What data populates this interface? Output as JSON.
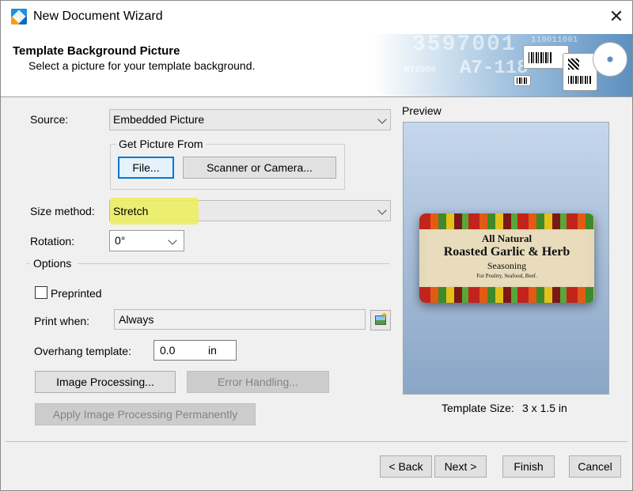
{
  "window": {
    "title": "New Document Wizard"
  },
  "header": {
    "title": "Template Background Picture",
    "subtitle": "Select a picture for your template background.",
    "banner_text": [
      "3597001",
      "A7-118",
      "RY2000",
      "110011001"
    ]
  },
  "source": {
    "label": "Source:",
    "value": "Embedded Picture"
  },
  "get_picture": {
    "label": "Get Picture From",
    "file_button": "File...",
    "scanner_button": "Scanner or Camera..."
  },
  "size_method": {
    "label": "Size method:",
    "value": "Stretch"
  },
  "rotation": {
    "label": "Rotation:",
    "value": "0°"
  },
  "options": {
    "label": "Options",
    "preprinted_label": "Preprinted",
    "preprinted_checked": false,
    "print_when_label": "Print when:",
    "print_when_value": "Always",
    "overhang_label": "Overhang template:",
    "overhang_value": "0.0",
    "overhang_unit": "in",
    "image_processing_button": "Image Processing...",
    "error_handling_button": "Error Handling...",
    "apply_button": "Apply Image Processing Permanently"
  },
  "preview": {
    "label": "Preview",
    "label_art": {
      "line1": "All Natural",
      "line2": "Roasted Garlic & Herb",
      "line3": "Seasoning",
      "line4": "For Poultry, Seafood, Beef."
    },
    "size_label": "Template Size:",
    "size_value": "3 x 1.5 in"
  },
  "footer": {
    "back": "< Back",
    "next": "Next >",
    "finish": "Finish",
    "cancel": "Cancel"
  },
  "colors": {
    "highlight": "#ecee5a",
    "focus_border": "#0078d7",
    "preview_bg": "#a9bfd9"
  }
}
